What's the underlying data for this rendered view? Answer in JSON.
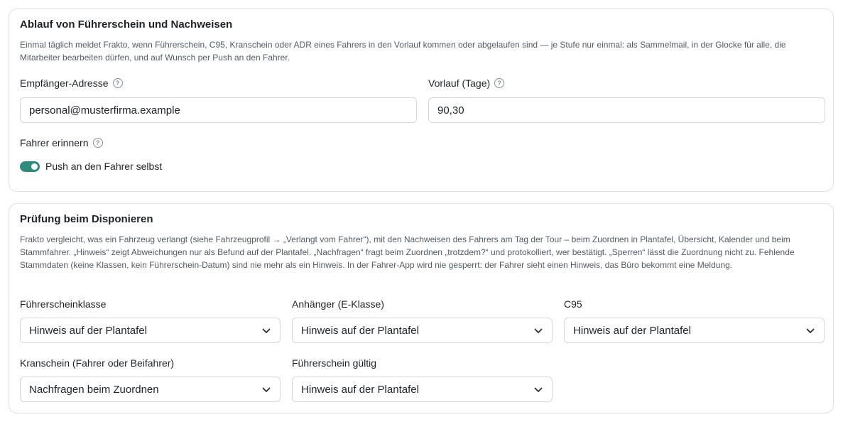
{
  "notifications": {
    "title": "Ablauf von Führerschein und Nachweisen",
    "description": "Einmal täglich meldet Frakto, wenn Führerschein, C95, Kranschein oder ADR eines Fahrers in den Vorlauf kommen oder abgelaufen sind — je Stufe nur einmal: als Sammelmail, in der Glocke für alle, die Mitarbeiter bearbeiten dürfen, und auf Wunsch per Push an den Fahrer.",
    "recipient_label": "Empfänger-Adresse",
    "recipient_value": "personal@musterfirma.example",
    "lead_label": "Vorlauf (Tage)",
    "lead_value": "90,30",
    "remind_label": "Fahrer erinnern",
    "push_label": "Push an den Fahrer selbst",
    "push_enabled": true
  },
  "dispatch_check": {
    "title": "Prüfung beim Disponieren",
    "description": "Frakto vergleicht, was ein Fahrzeug verlangt (siehe Fahrzeugprofil → „Verlangt vom Fahrer“), mit den Nachweisen des Fahrers am Tag der Tour – beim Zuordnen in Plantafel, Übersicht, Kalender und beim Stammfahrer. „Hinweis“ zeigt Abweichungen nur als Befund auf der Plantafel. „Nachfragen“ fragt beim Zuordnen „trotzdem?“ und protokolliert, wer bestätigt. „Sperren“ lässt die Zuordnung nicht zu. Fehlende Stammdaten (keine Klassen, kein Führerschein-Datum) sind nie mehr als ein Hinweis. In der Fahrer-App wird nie gesperrt: der Fahrer sieht einen Hinweis, das Büro bekommt eine Meldung.",
    "fields": [
      {
        "label": "Führerscheinklasse",
        "value": "Hinweis auf der Plantafel"
      },
      {
        "label": "Anhänger (E-Klasse)",
        "value": "Hinweis auf der Plantafel"
      },
      {
        "label": "C95",
        "value": "Hinweis auf der Plantafel"
      },
      {
        "label": "Kranschein (Fahrer oder Beifahrer)",
        "value": "Nachfragen beim Zuordnen"
      },
      {
        "label": "Führerschein gültig",
        "value": "Hinweis auf der Plantafel"
      }
    ]
  },
  "colors": {
    "accent": "#2f8a7e",
    "border": "#dcdfe3",
    "muted_text": "#545b64"
  }
}
